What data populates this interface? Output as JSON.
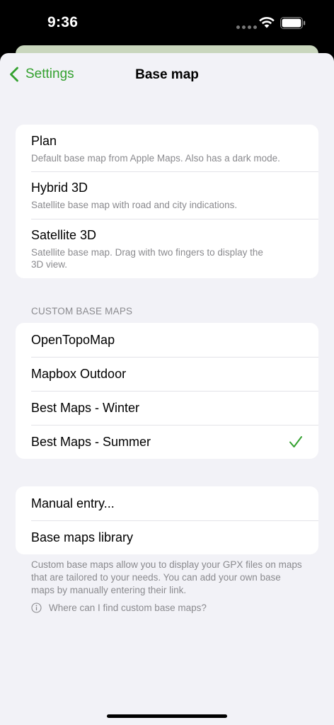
{
  "status_bar": {
    "time": "9:36"
  },
  "nav": {
    "back_label": "Settings",
    "title": "Base map"
  },
  "base_maps": [
    {
      "title": "Plan",
      "subtitle": "Default base map from Apple Maps. Also has a dark mode."
    },
    {
      "title": "Hybrid 3D",
      "subtitle": "Satellite base map with road and city indications."
    },
    {
      "title": "Satellite 3D",
      "subtitle": "Satellite base map. Drag with two fingers to display the 3D view."
    }
  ],
  "custom": {
    "header": "CUSTOM BASE MAPS",
    "items": [
      {
        "title": "OpenTopoMap",
        "selected": false
      },
      {
        "title": "Mapbox Outdoor",
        "selected": false
      },
      {
        "title": "Best Maps - Winter",
        "selected": false
      },
      {
        "title": "Best Maps - Summer",
        "selected": true
      }
    ]
  },
  "actions": {
    "items": [
      {
        "title": "Manual entry..."
      },
      {
        "title": "Base maps library"
      }
    ],
    "footer": "Custom base maps allow you to display your GPX files on maps that are tailored to your needs. You can add your own base maps by manually entering their link.",
    "help_link": "Where can I find custom base maps?"
  },
  "colors": {
    "accent": "#34a12f",
    "background": "#f2f2f7",
    "secondary_text": "#8a8a8e"
  },
  "icons": {
    "back": "chevron-left-icon",
    "check": "checkmark-icon",
    "info": "info-circle-icon",
    "wifi": "wifi-icon",
    "battery": "battery-icon"
  }
}
